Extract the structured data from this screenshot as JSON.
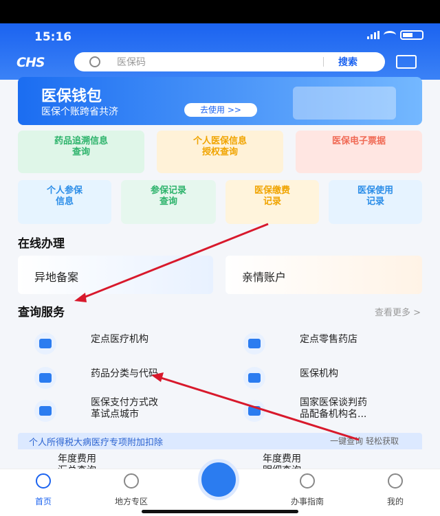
{
  "status_bar": {
    "time": "15:16"
  },
  "header": {
    "logo": "CHS",
    "search_placeholder": "医保码",
    "search_button": "搜索"
  },
  "banner": {
    "title": "医保钱包",
    "subtitle": "医保个账跨省共济",
    "button": "去使用 >>"
  },
  "top_cards": [
    {
      "label": "药品追溯信息\n查询"
    },
    {
      "label": "个人医保信息\n授权查询"
    },
    {
      "label": "医保电子票据"
    }
  ],
  "second_cards": [
    {
      "label": "个人参保\n信息"
    },
    {
      "label": "参保记录\n查询"
    },
    {
      "label": "医保缴费\n记录"
    },
    {
      "label": "医保使用\n记录"
    }
  ],
  "online": {
    "title": "在线办理",
    "items": [
      "异地备案",
      "亲情账户"
    ]
  },
  "query": {
    "title": "查询服务",
    "view_more": "查看更多 >",
    "services": [
      "定点医疗机构",
      "定点零售药店",
      "药品分类与代码",
      "医保机构",
      "医保支付方式改\n革试点城市",
      "国家医保谈判药\n品配备机构名..."
    ]
  },
  "tax": {
    "title": "个人所得税大病医疗专项附加扣除",
    "right": "一键查询 轻松获取",
    "fee_left": "年度费用\n汇总查询",
    "fee_right": "年度费用\n明细查询"
  },
  "tabbar": {
    "home": "首页",
    "local": "地方专区",
    "guide": "办事指南",
    "mine": "我的"
  },
  "colors": {
    "primary": "#1b63f0",
    "arrow": "#d8192c"
  }
}
